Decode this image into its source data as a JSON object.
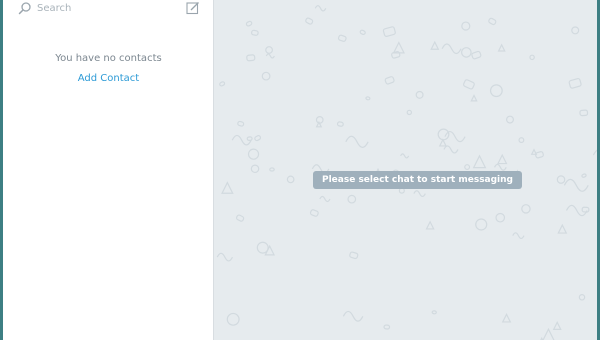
{
  "sidebar": {
    "search": {
      "placeholder": "Search",
      "value": ""
    },
    "compose_icon": "compose-icon",
    "empty_text": "You have no contacts",
    "add_contact_label": "Add Contact"
  },
  "chat": {
    "empty_message": "Please select chat to start messaging",
    "background_pattern": "doodle-wallpaper"
  },
  "colors": {
    "frame": "#3d7f83",
    "link": "#2e9bd6",
    "chat_background": "#e6ebee",
    "badge_background": "#9fb0bc"
  }
}
